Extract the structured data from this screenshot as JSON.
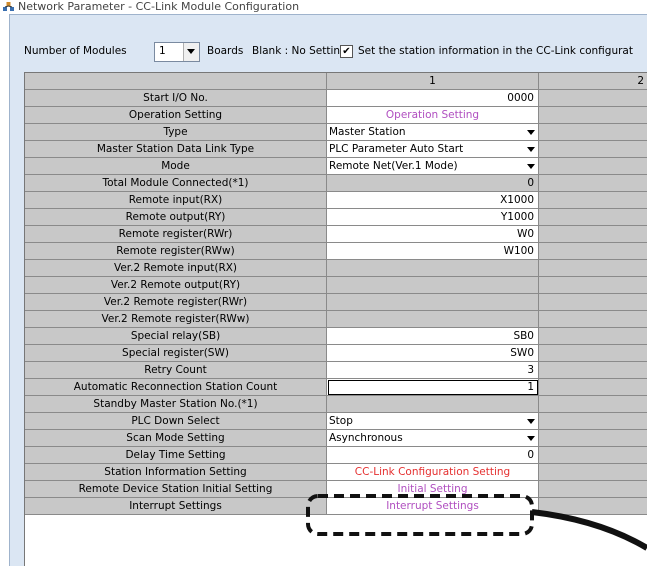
{
  "window": {
    "title": "Network Parameter - CC-Link Module Configuration"
  },
  "toolbar": {
    "modules_label": "Number of Modules",
    "modules_value": "1",
    "boards_label": "Boards",
    "blank_label": "Blank : No Setting",
    "station_info_checked": "✔",
    "station_info_label": "Set the station information in the CC-Link configurat"
  },
  "table": {
    "columns": [
      "1",
      "2"
    ],
    "rows": [
      {
        "label": "Start I/O No.",
        "value": "0000"
      },
      {
        "label": "Operation Setting",
        "value": "Operation Setting"
      },
      {
        "label": "Type",
        "value": "Master Station"
      },
      {
        "label": "Master Station Data Link Type",
        "value": "PLC Parameter Auto Start"
      },
      {
        "label": "Mode",
        "value": "Remote Net(Ver.1 Mode)"
      },
      {
        "label": "Total Module Connected(*1)",
        "value": "0"
      },
      {
        "label": "Remote input(RX)",
        "value": "X1000"
      },
      {
        "label": "Remote output(RY)",
        "value": "Y1000"
      },
      {
        "label": "Remote register(RWr)",
        "value": "W0"
      },
      {
        "label": "Remote register(RWw)",
        "value": "W100"
      },
      {
        "label": "Ver.2 Remote input(RX)",
        "value": ""
      },
      {
        "label": "Ver.2 Remote output(RY)",
        "value": ""
      },
      {
        "label": "Ver.2 Remote register(RWr)",
        "value": ""
      },
      {
        "label": "Ver.2 Remote register(RWw)",
        "value": ""
      },
      {
        "label": "Special relay(SB)",
        "value": "SB0"
      },
      {
        "label": "Special register(SW)",
        "value": "SW0"
      },
      {
        "label": "Retry Count",
        "value": "3"
      },
      {
        "label": "Automatic Reconnection Station Count",
        "value": "1"
      },
      {
        "label": "Standby Master Station No.(*1)",
        "value": ""
      },
      {
        "label": "PLC Down Select",
        "value": "Stop"
      },
      {
        "label": "Scan Mode Setting",
        "value": "Asynchronous"
      },
      {
        "label": "Delay Time Setting",
        "value": "0"
      },
      {
        "label": "Station Information Setting",
        "value": "CC-Link Configuration Setting"
      },
      {
        "label": "Remote Device Station Initial Setting",
        "value": "Initial Setting"
      },
      {
        "label": "Interrupt Settings",
        "value": "Interrupt Settings"
      }
    ]
  },
  "colors": {
    "button_text": "#b04fc0",
    "highlight_button_text": "#e53030",
    "label_bg": "#c8c8c8"
  }
}
